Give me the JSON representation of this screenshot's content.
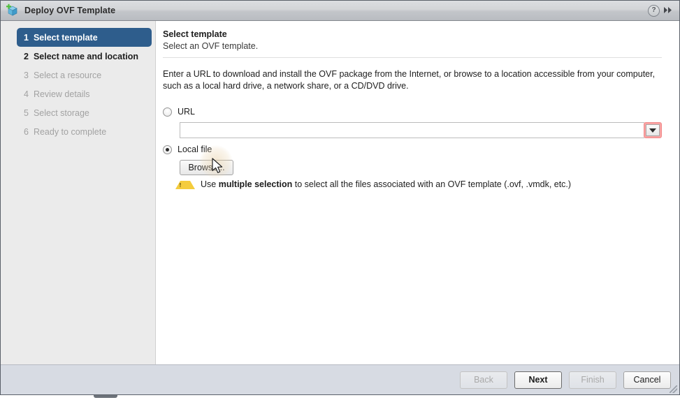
{
  "window": {
    "title": "Deploy OVF Template",
    "icon": "ovf-template-icon",
    "help_label": "?",
    "collapse_label": "▶▶"
  },
  "sidebar": {
    "steps": [
      {
        "num": "1",
        "label": "Select template",
        "state": "current"
      },
      {
        "num": "2",
        "label": "Select name and location",
        "state": "done"
      },
      {
        "num": "3",
        "label": "Select a resource",
        "state": "pending"
      },
      {
        "num": "4",
        "label": "Review details",
        "state": "pending"
      },
      {
        "num": "5",
        "label": "Select storage",
        "state": "pending"
      },
      {
        "num": "6",
        "label": "Ready to complete",
        "state": "pending"
      }
    ]
  },
  "content": {
    "heading": "Select template",
    "subheading": "Select an OVF template.",
    "description": "Enter a URL to download and install the OVF package from the Internet, or browse to a location accessible from your computer, such as a local hard drive, a network share, or a CD/DVD drive.",
    "url_option": {
      "label": "URL",
      "selected": false,
      "value": "",
      "placeholder": "",
      "dropdown_icon": "chevron-down-icon",
      "highlight_color": "#f9a3a3"
    },
    "local_file_option": {
      "label": "Local file",
      "selected": true,
      "browse_label": "Browse..."
    },
    "warning": {
      "icon": "warning-triangle-icon",
      "text_before": "Use ",
      "text_bold": "multiple selection",
      "text_after": " to select all the files associated with an OVF template (.ovf, .vmdk, etc.)"
    }
  },
  "footer": {
    "buttons": [
      {
        "label": "Back",
        "state": "disabled"
      },
      {
        "label": "Next",
        "state": "primary"
      },
      {
        "label": "Finish",
        "state": "disabled"
      },
      {
        "label": "Cancel",
        "state": "normal"
      }
    ]
  },
  "colors": {
    "step_active": "#2e5d8c",
    "footer_bg": "#d7dbe3",
    "sidebar_bg": "#ebebeb",
    "warning_yellow": "#f4cc3d",
    "error_highlight": "#f9a3a3"
  }
}
